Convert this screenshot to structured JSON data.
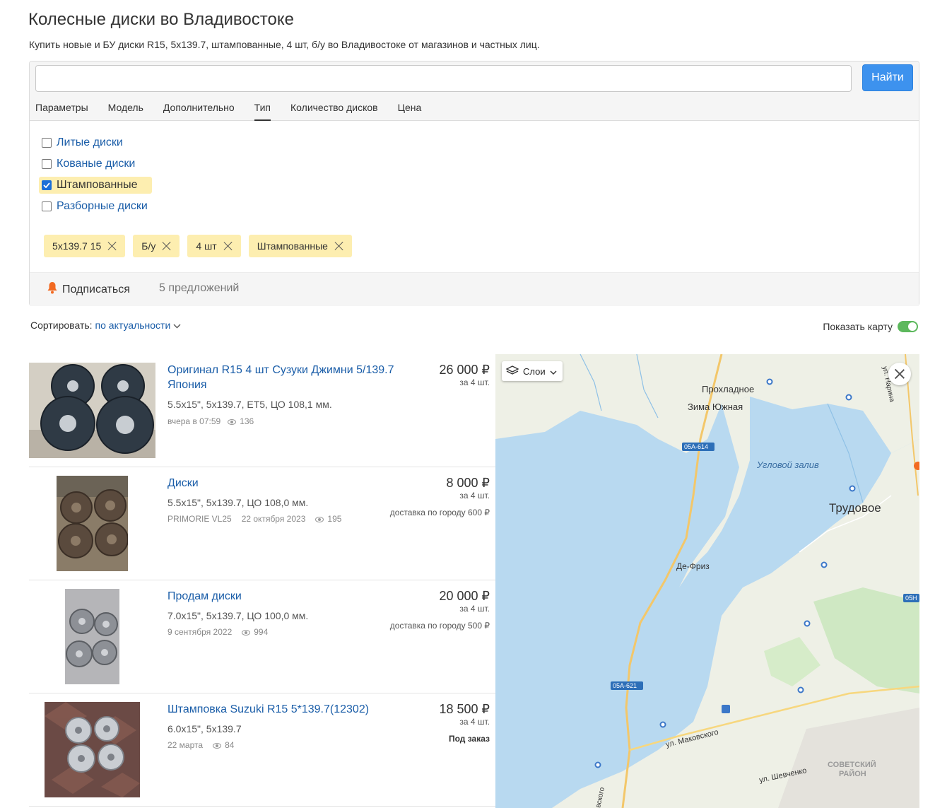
{
  "page": {
    "title": "Колесные диски во Владивостоке",
    "subtitle": "Купить новые и БУ диски R15, 5x139.7, штампованные, 4 шт, б/у во Владивостоке от магазинов и частных лиц."
  },
  "search": {
    "value": "",
    "button_label": "Найти"
  },
  "tabs": [
    "Параметры",
    "Модель",
    "Дополнительно",
    "Тип",
    "Количество дисков",
    "Цена"
  ],
  "type_options": [
    {
      "label": "Литые диски",
      "checked": false
    },
    {
      "label": "Кованые диски",
      "checked": false
    },
    {
      "label": "Штампованные",
      "checked": true
    },
    {
      "label": "Разборные диски",
      "checked": false
    }
  ],
  "chips": [
    "5x139.7 15",
    "Б/у",
    "4 шт",
    "Штампованные"
  ],
  "subscribe": {
    "label": "Подписаться",
    "count": "5 предложений"
  },
  "sort": {
    "label": "Сортировать:",
    "value": "по актуальности"
  },
  "map_toggle": {
    "label": "Показать карту",
    "on": true
  },
  "listings": [
    {
      "title": "Оригинал R15 4 шт Сузуки Джимни 5/139.7 Япония",
      "spec": "5.5x15\", 5x139.7, ET5, ЦО 108,1 мм.",
      "seller": "",
      "date": "вчера в 07:59",
      "views": "136",
      "price": "26 000 ₽",
      "per": "за 4 шт.",
      "delivery": "",
      "order": ""
    },
    {
      "title": "Диски",
      "spec": "5.5x15\", 5x139.7, ЦО 108,0 мм.",
      "seller": "PRIMORIE VL25",
      "date": "22 октября 2023",
      "views": "195",
      "price": "8 000 ₽",
      "per": "за 4 шт.",
      "delivery": "доставка по городу 600 ₽",
      "order": ""
    },
    {
      "title": "Продам диски",
      "spec": "7.0x15\", 5x139.7, ЦО 100,0 мм.",
      "seller": "",
      "date": "9 сентября 2022",
      "views": "994",
      "price": "20 000 ₽",
      "per": "за 4 шт.",
      "delivery": "доставка по городу 500 ₽",
      "order": ""
    },
    {
      "title": "Штамповка Suzuki R15 5*139.7(12302)",
      "spec": "6.0x15\", 5x139.7",
      "seller": "",
      "date": "22 марта",
      "views": "84",
      "price": "18 500 ₽",
      "per": "за 4 шт.",
      "delivery": "",
      "order": "Под заказ"
    }
  ],
  "map": {
    "layers_label": "Слои",
    "labels": {
      "prokhladnoe": "Прохладное",
      "zima": "Зима Южная",
      "bay": "Угловой залив",
      "trudovoe": "Трудовое",
      "defriz": "Де-Фриз",
      "makovskogo": "ул. Маковского",
      "shevchenko": "ул. Шевченко",
      "sovetsky": "СОВЕТСКИЙ",
      "raion": "РАЙОН",
      "road1": "05А-614",
      "road2": "05А-621",
      "road3": "05Н",
      "narina": "ул. Нарина",
      "vskogo": "вского"
    }
  },
  "colors": {
    "accent": "#3d92ee",
    "link": "#1a5da8",
    "chip": "#fdeeb0",
    "toggle": "#5cb85c",
    "water": "#b8d9f0"
  }
}
